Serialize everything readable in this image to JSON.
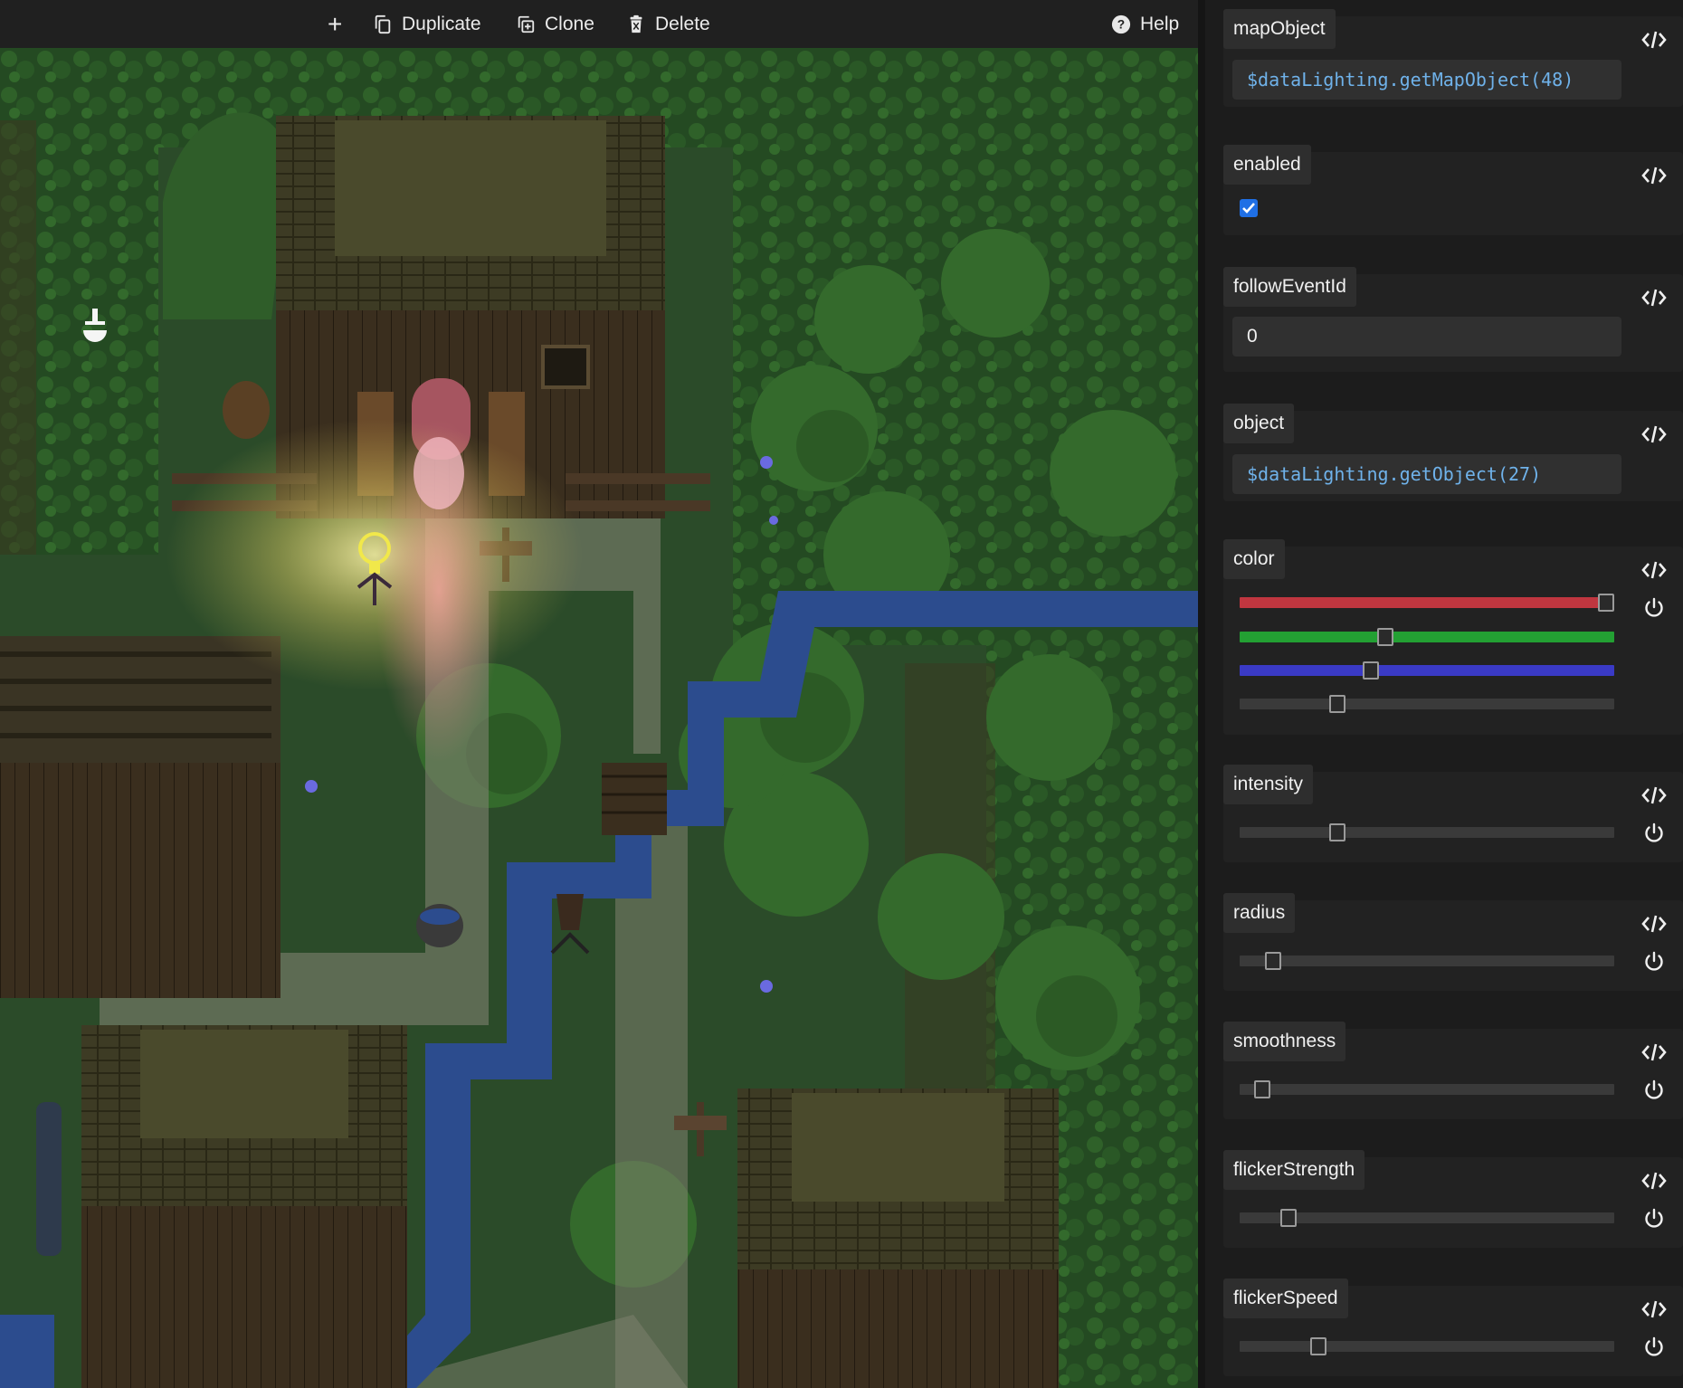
{
  "toolbar": {
    "add_label": "+",
    "duplicate_label": "Duplicate",
    "clone_label": "Clone",
    "delete_label": "Delete",
    "help_label": "Help"
  },
  "properties": {
    "mapObject": {
      "label": "mapObject",
      "value": "$dataLighting.getMapObject(48)"
    },
    "enabled": {
      "label": "enabled",
      "checked": true
    },
    "followEventId": {
      "label": "followEventId",
      "value": "0"
    },
    "object": {
      "label": "object",
      "value": "$dataLighting.getObject(27)"
    },
    "color": {
      "label": "color",
      "channels": [
        {
          "name": "red",
          "fraction": 1.0,
          "track_color": "#c0363f"
        },
        {
          "name": "green",
          "fraction": 0.39,
          "track_color": "#23a033"
        },
        {
          "name": "blue",
          "fraction": 0.35,
          "track_color": "#3a3ac6"
        },
        {
          "name": "alpha",
          "fraction": 0.26,
          "track_color": "#3a3a3a"
        }
      ]
    },
    "intensity": {
      "label": "intensity",
      "fraction": 0.26
    },
    "radius": {
      "label": "radius",
      "fraction": 0.09
    },
    "smoothness": {
      "label": "smoothness",
      "fraction": 0.06
    },
    "flickerStrength": {
      "label": "flickerStrength",
      "fraction": 0.13
    },
    "flickerSpeed": {
      "label": "flickerSpeed",
      "fraction": 0.21
    }
  },
  "icons": {
    "add": "plus-icon",
    "duplicate": "duplicate-icon",
    "clone": "clone-icon",
    "delete": "trash-icon",
    "help": "help-circle-icon",
    "code": "code-icon",
    "power": "power-icon",
    "check": "check-icon"
  },
  "colors": {
    "code_text": "#6fb2ea",
    "checkbox": "#1f6fe5",
    "panel_bg": "#1c1c1c",
    "toolbar_bg": "#202020"
  }
}
